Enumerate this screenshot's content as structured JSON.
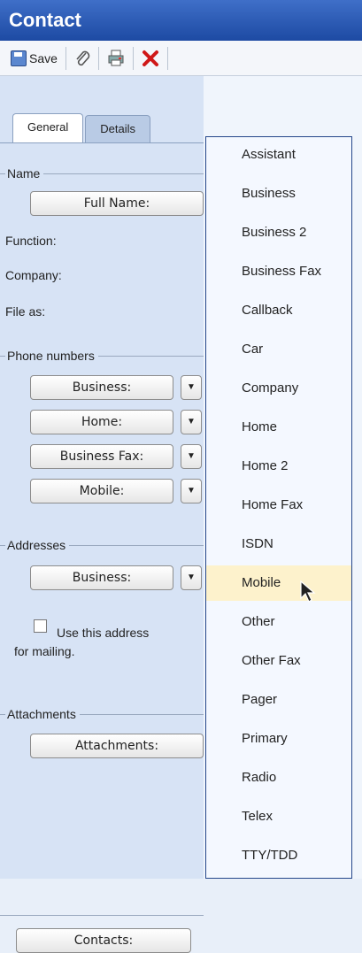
{
  "window": {
    "title": "Contact"
  },
  "toolbar": {
    "save_label": "Save"
  },
  "tabs": [
    "General",
    "Details"
  ],
  "sections": {
    "name": "Name",
    "phone": "Phone numbers",
    "addresses": "Addresses",
    "attachments": "Attachments"
  },
  "name_section": {
    "full_name_button": "Full Name:",
    "function_label": "Function:",
    "company_label": "Company:",
    "file_as_label": "File as:"
  },
  "phone_buttons": [
    "Business:",
    "Home:",
    "Business Fax:",
    "Mobile:"
  ],
  "address_section": {
    "business_button": "Business:",
    "mailing_checkbox_label_line1": "Use this address",
    "mailing_checkbox_label_line2": "for mailing."
  },
  "attachments_button": "Attachments:",
  "contacts_button": "Contacts:",
  "dropdown_menu": {
    "items": [
      "Assistant",
      "Business",
      "Business 2",
      "Business Fax",
      "Callback",
      "Car",
      "Company",
      "Home",
      "Home 2",
      "Home Fax",
      "ISDN",
      "Mobile",
      "Other",
      "Other Fax",
      "Pager",
      "Primary",
      "Radio",
      "Telex",
      "TTY/TDD"
    ],
    "highlighted": "Mobile"
  }
}
